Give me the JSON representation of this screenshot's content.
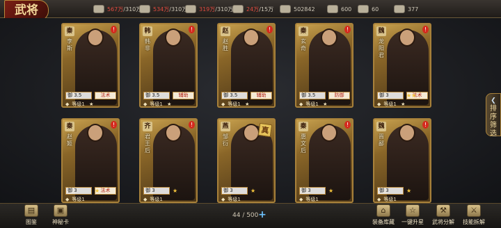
{
  "header": {
    "title": "武将"
  },
  "resources": [
    {
      "icon": "coin-bundle-icon",
      "current": "567万",
      "max": "/310万"
    },
    {
      "icon": "grain-icon",
      "current": "534万",
      "max": "/310万"
    },
    {
      "icon": "brick-icon",
      "current": "319万",
      "max": "/310万"
    },
    {
      "icon": "iron-ingot-icon",
      "current": "24万",
      "max": "/15万"
    },
    {
      "icon": "sword-icon",
      "value": "502842"
    },
    {
      "icon": "silver-coin-icon",
      "value": "600"
    },
    {
      "icon": "bowl-icon",
      "value": "60"
    },
    {
      "icon": "ingot-icon",
      "value": "377"
    }
  ],
  "cards": [
    {
      "kingdom": "秦",
      "name": "李斯",
      "stat": "御 3.5",
      "role": "法术",
      "level": "等级1"
    },
    {
      "kingdom": "韩",
      "name": "韩非",
      "stat": "御 3.5",
      "role": "辅助",
      "level": "等级1"
    },
    {
      "kingdom": "赵",
      "name": "赵胜",
      "stat": "御 3.5",
      "role": "辅助",
      "level": "等级1"
    },
    {
      "kingdom": "秦",
      "name": "玄奇",
      "stat": "御 3.5",
      "role": "防御",
      "level": "等级1"
    },
    {
      "kingdom": "魏",
      "name": "龙阳君",
      "stat": "御 3",
      "role": "法术",
      "level": "等级1"
    },
    {
      "kingdom": "秦",
      "name": "赵姬",
      "stat": "御 3",
      "role": "法术",
      "level": "等级1"
    },
    {
      "kingdom": "齐",
      "name": "君王后",
      "stat": "御 3",
      "role": "",
      "level": "等级1"
    },
    {
      "kingdom": "燕",
      "name": "邹衍",
      "stat": "御 3",
      "role": "",
      "level": "等级1",
      "badge": "真"
    },
    {
      "kingdom": "秦",
      "name": "惠文后",
      "stat": "御 3",
      "role": "",
      "level": "等级1"
    },
    {
      "kingdom": "魏",
      "name": "晋鄙",
      "stat": "御 3",
      "role": "",
      "level": "等级1"
    }
  ],
  "sort_button": {
    "line1": "排",
    "line2": "序",
    "line3": "筛",
    "line4": "选"
  },
  "bottom": {
    "left": [
      {
        "label": "图鉴",
        "icon": "book-icon"
      },
      {
        "label": "神秘卡",
        "icon": "mystery-card-icon"
      }
    ],
    "count": "44 / 500",
    "right": [
      {
        "label": "装备库藏",
        "icon": "treasure-chest-icon"
      },
      {
        "label": "一键升星",
        "icon": "star-upgrade-icon"
      },
      {
        "label": "武将分解",
        "icon": "decompose-icon"
      },
      {
        "label": "技能拆解",
        "icon": "skill-dismantle-icon"
      }
    ]
  }
}
